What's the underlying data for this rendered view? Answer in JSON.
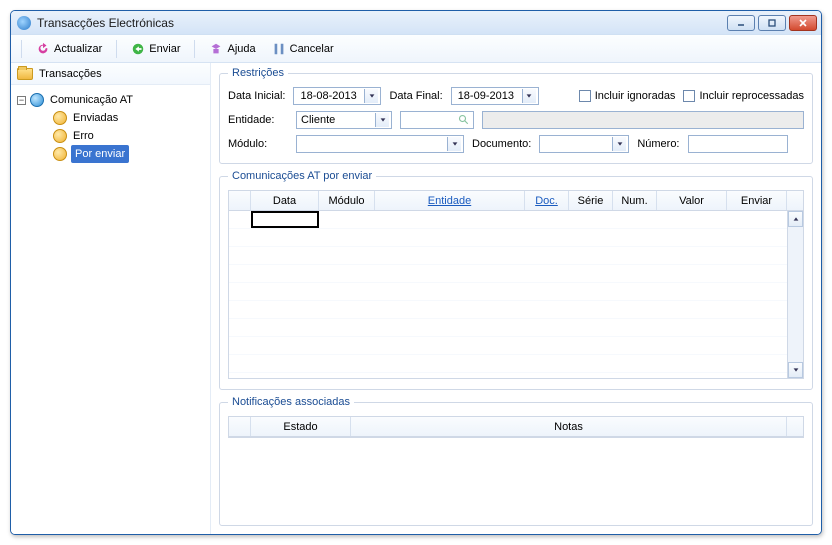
{
  "window": {
    "title": "Transacções Electrónicas"
  },
  "toolbar": {
    "actualizar": "Actualizar",
    "enviar": "Enviar",
    "ajuda": "Ajuda",
    "cancelar": "Cancelar"
  },
  "sidebar": {
    "header": "Transacções",
    "root": "Comunicação AT",
    "items": [
      "Enviadas",
      "Erro",
      "Por enviar"
    ],
    "selected_index": 2
  },
  "restricoes": {
    "legend": "Restrições",
    "data_inicial_label": "Data Inicial:",
    "data_inicial_value": "18-08-2013",
    "data_final_label": "Data Final:",
    "data_final_value": "18-09-2013",
    "incluir_ignoradas": "Incluir ignoradas",
    "incluir_reprocessadas": "Incluir reprocessadas",
    "entidade_label": "Entidade:",
    "entidade_value": "Cliente",
    "modulo_label": "Módulo:",
    "documento_label": "Documento:",
    "numero_label": "Número:"
  },
  "grid1": {
    "legend": "Comunicações AT por enviar",
    "cols": {
      "data": "Data",
      "modulo": "Módulo",
      "entidade": "Entidade",
      "doc": "Doc.",
      "serie": "Série",
      "num": "Num.",
      "valor": "Valor",
      "enviar": "Enviar"
    }
  },
  "grid2": {
    "legend": "Notificações associadas",
    "cols": {
      "estado": "Estado",
      "notas": "Notas"
    }
  }
}
